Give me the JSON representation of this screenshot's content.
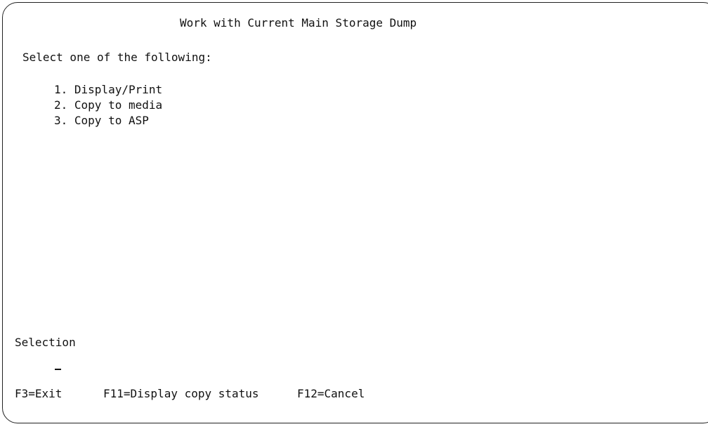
{
  "screen": {
    "title": "Work with Current Main Storage Dump",
    "prompt": "Select one of the following:"
  },
  "options": [
    {
      "label": "1. Display/Print"
    },
    {
      "label": "2. Copy to media"
    },
    {
      "label": "3. Copy to ASP"
    }
  ],
  "selection": {
    "label": "Selection",
    "value": ""
  },
  "function_keys": [
    {
      "label": "F3=Exit"
    },
    {
      "label": "F11=Display copy status"
    },
    {
      "label": "F12=Cancel"
    }
  ]
}
